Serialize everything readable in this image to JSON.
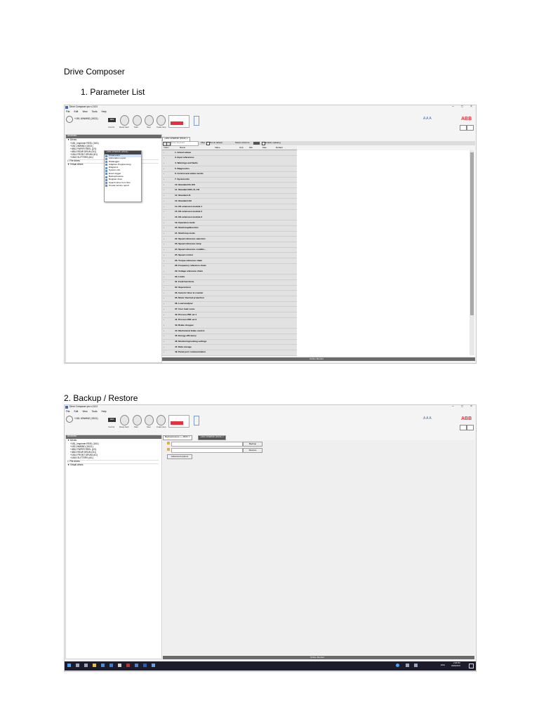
{
  "doc": {
    "title": "Drive Composer",
    "section1": "1.    Parameter List",
    "section2": "2. Backup / Restore"
  },
  "app": {
    "window_title": "Drive Composer pro v.2.8.0",
    "menu": [
      "File",
      "Edit",
      "View",
      "Tools",
      "Help"
    ],
    "drive_status": "+1B1 UNWIND (15/21)",
    "mode_badge": "REM",
    "toolbar_labels": [
      "Control",
      "Reset fault",
      "Start",
      "Stop",
      "Coast stop",
      "Reference"
    ],
    "brand": "ABB",
    "zoom": "A A A",
    "window_controls": [
      "–",
      "□",
      "×"
    ],
    "colors": {
      "accent": "#e8303a",
      "brand": "#e8303a",
      "selection": "#cfe3ff"
    }
  },
  "tree": {
    "header": "All drives",
    "group": "Drives",
    "drives": [
      "+1B1_Inspinner REEL (16/1)",
      "+1B1 UNWIND (15/21)",
      "+4B12 PAPER REEL (2/1)",
      "+4B13 REAR DRUM (3/1)",
      "+1B14 FRONT DRUM (4/1)",
      "+1B15 SLITTERS (6/1)"
    ],
    "file_drives": "File drives",
    "virtual_drives": "Virtual drives"
  },
  "context_menu": {
    "header": "+1B1 UNWIND (15/21)",
    "items": [
      "Parameters",
      "Information report",
      "Datalogger",
      "Adaptive Programming",
      "Diagrams",
      "System info",
      "Event logger",
      "Backup/restore",
      "Register drive",
      "Search drive from SIG",
      "Create service report"
    ]
  },
  "params": {
    "tab": "+1B1 UNWIND (15/21)",
    "filter_placeholder": "Enter keyword",
    "filter_label": "Filter",
    "not_default": "Not at default",
    "select_columns": "Select columns",
    "enable_updating": "Enable updating",
    "columns": [
      "Index",
      "Name",
      "Value",
      "Unit",
      "Min",
      "Max",
      "Default"
    ],
    "groups": [
      "1. Actual values",
      "3. Input references",
      "4. Warnings and faults",
      "5. Diagnostics",
      "6. Control and status words",
      "7. System info",
      "10. Standard DI, RO",
      "11. Standard DIO, FI, FO",
      "12. Standard AI",
      "13. Standard AO",
      "14. I/O extension module 1",
      "15. I/O extension module 2",
      "16. I/O extension module 3",
      "19. Operation mode",
      "20. Start/stop/direction",
      "21. Start/stop mode",
      "22. Speed reference selection",
      "23. Speed reference ramp",
      "24. Speed reference conditio...",
      "25. Speed control",
      "26. Torque reference chain",
      "28. Frequency reference chain",
      "29. Voltage reference chain",
      "30. Limits",
      "31. Fault functions",
      "32. Supervision",
      "33. Generic timer & counter",
      "35. Motor thermal protection",
      "36. Load analyzer",
      "37. User load curve",
      "40. Process PID set 1",
      "41. Process PID set 2",
      "43. Brake chopper",
      "44. Mechanical brake control",
      "45. Energy efficiency",
      "46. Monitoring/scaling settings",
      "47. Data storage",
      "49. Panel port communication"
    ],
    "monitor": "Online Monitor"
  },
  "backup": {
    "tabs": [
      "Backup/restore +_15/21",
      "+1B1 UNWIND (15/21)"
    ],
    "backup_button": "Backup",
    "restore_button": "Restore",
    "advanced_button": "Advanced options",
    "monitor": "Online Monitor"
  },
  "taskbar": {
    "time": "2:08 PM",
    "date": "29/09/2022",
    "lang": "ENG"
  }
}
